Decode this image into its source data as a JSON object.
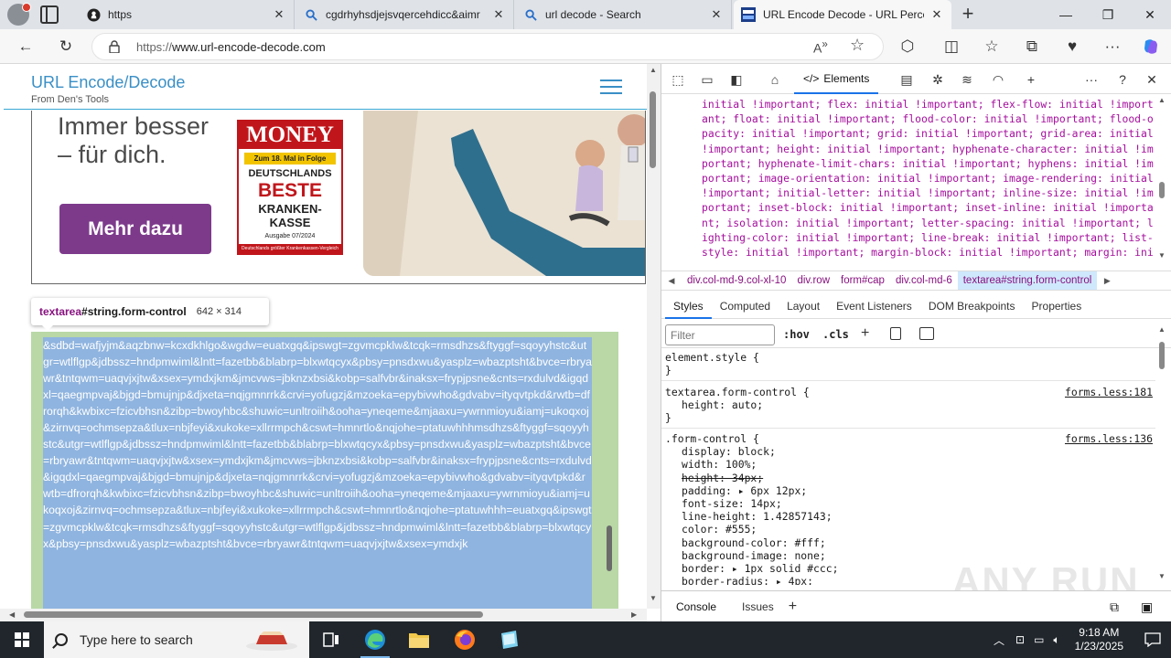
{
  "browser": {
    "tabs": [
      {
        "title": "https",
        "icon": "github-icon"
      },
      {
        "title": "cgdrhyhsdjejsvqercehdicc&aimr",
        "icon": "search-icon"
      },
      {
        "title": "url decode - Search",
        "icon": "search-icon"
      },
      {
        "title": "URL Encode Decode - URL Percent",
        "icon": "site-favicon",
        "active": true
      }
    ],
    "url_prefix": "https://",
    "url_host": "www.url-encode-decode.com"
  },
  "site": {
    "title": "URL Encode/Decode",
    "subtitle": "From Den's Tools"
  },
  "ad": {
    "headline": "Immer besser\n– für dich.",
    "button": "Mehr dazu",
    "badge_logo": "MONEY",
    "badge_ribbon": "Zum 18. Mal in Folge",
    "badge_line1": "DEUTSCHLANDS",
    "badge_line2": "BESTE",
    "badge_line3": "KRANKEN-\nKASSE",
    "badge_issue": "Ausgabe 07/2024",
    "badge_footer": "Deutschlands größter Krankenkassen-Vergleich"
  },
  "inspector_tooltip": {
    "tag": "textarea",
    "selector": "#string.form-control",
    "size": "642 × 314"
  },
  "textarea": {
    "content": "&sdbd=wafjyjm&aqzbnw=kcxdkhlgo&wgdw=euatxgq&ipswgt=zgvmcpklw&tcqk=rmsdhzs&ftyggf=sqoyyhstc&utgr=wtlflgp&jdbssz=hndpmwiml&lntt=fazetbb&blabrp=blxwtqcyx&pbsy=pnsdxwu&yasplz=wbazptsht&bvce=rbryawr&tntqwm=uaqvjxjtw&xsex=ymdxjkm&jmcvws=jbknzxbsi&kobp=salfvbr&inaksx=frypjpsne&cnts=rxdulvd&igqdxl=qaegmpvaj&bjgd=bmujnjp&djxeta=nqjgmnrrk&crvi=yofugzj&mzoeka=epybivwho&gdvabv=ityqvtpkd&rwtb=dfrorqh&kwbixc=fzicvbhsn&zibp=bwoyhbc&shuwic=unltroiih&ooha=yneqeme&mjaaxu=ywrnmioyu&iamj=ukoqxoj&zirnvq=ochmsepza&tlux=nbjfeyi&xukoke=xllrrmpch&cswt=hmnrtlo&nqjohe=ptatuwhhhmsdhzs&ftyggf=sqoyyhstc&utgr=wtlflgp&jdbssz=hndpmwiml&lntt=fazetbb&blabrp=blxwtqcyx&pbsy=pnsdxwu&yasplz=wbazptsht&bvce=rbryawr&tntqwm=uaqvjxjtw&xsex=ymdxjkm&jmcvws=jbknzxbsi&kobp=salfvbr&inaksx=frypjpsne&cnts=rxdulvd&igqdxl=qaegmpvaj&bjgd=bmujnjp&djxeta=nqjgmnrrk&crvi=yofugzj&mzoeka=epybivwho&gdvabv=ityqvtpkd&rwtb=dfrorqh&kwbixc=fzicvbhsn&zibp=bwoyhbc&shuwic=unltroiih&ooha=yneqeme&mjaaxu=ywrnmioyu&iamj=ukoqxoj&zirnvq=ochmsepza&tlux=nbjfeyi&xukoke=xllrrmpch&cswt=hmnrtlo&nqjohe=ptatuwhhh=euatxgq&ipswgt=zgvmcpklw&tcqk=rmsdhzs&ftyggf=sqoyyhstc&utgr=wtlflgp&jdbssz=hndpmwiml&lntt=fazetbb&blabrp=blxwtqcyx&pbsy=pnsdxwu&yasplz=wbazptsht&bvce=rbryawr&tntqwm=uaqvjxjtw&xsex=ymdxjk"
  },
  "devtools": {
    "active_tab": "Elements",
    "css_dump": "initial !important; flex: initial !important; flex-flow: initial !important; float: initial !important; flood-color: initial !important; flood-opacity: initial !important; grid: initial !important; grid-area: initial !important; height: initial !important; hyphenate-character: initial !important; hyphenate-limit-chars: initial !important; hyphens: initial !important; image-orientation: initial !important; image-rendering: initial !important; initial-letter: initial !important; inline-size: initial !important; inset-block: initial !important; inset-inline: initial !important; isolation: initial !important; letter-spacing: initial !important; lighting-color: initial !important; line-break: initial !important; list-style: initial !important; margin-block: initial !important; margin: initial !important; margin-inline: initial !important;",
    "breadcrumbs": [
      "div.col-md-9.col-xl-10",
      "div.row",
      "form#cap",
      "div.col-md-6",
      "textarea#string.form-control"
    ],
    "subtabs": [
      "Styles",
      "Computed",
      "Layout",
      "Event Listeners",
      "DOM Breakpoints",
      "Properties"
    ],
    "filter_placeholder": "Filter",
    "hov": ":hov",
    "cls": ".cls",
    "element_style": "element.style {",
    "close_brace": "}",
    "rule1_selector": "textarea.form-control {",
    "rule1_source": "forms.less:181",
    "rule1_prop": "height: auto;",
    "rule2_selector": ".form-control {",
    "rule2_source": "forms.less:136",
    "rule2_props": [
      "display: block;",
      "width: 100%;",
      "height: 34px;",
      "padding: ▸ 6px 12px;",
      "font-size: 14px;",
      "line-height: 1.42857143;",
      "color: #555;",
      "background-color: #fff;",
      "background-image: none;",
      "border: ▸ 1px solid #ccc;",
      "border-radius: ▸ 4px;"
    ],
    "drawer_tabs": [
      "Console",
      "Issues"
    ],
    "watermark": "ANY RUN"
  },
  "taskbar": {
    "search_placeholder": "Type here to search",
    "time": "9:18 AM",
    "date": "1/23/2025"
  },
  "colors": {
    "accent": "#1a73e8",
    "site_blue": "#3a8fc6",
    "ad_purple": "#7d3a8b",
    "money_red": "#c0161b",
    "highlight_green": "#b9d8a6",
    "selection_blue": "#8fb4df"
  }
}
